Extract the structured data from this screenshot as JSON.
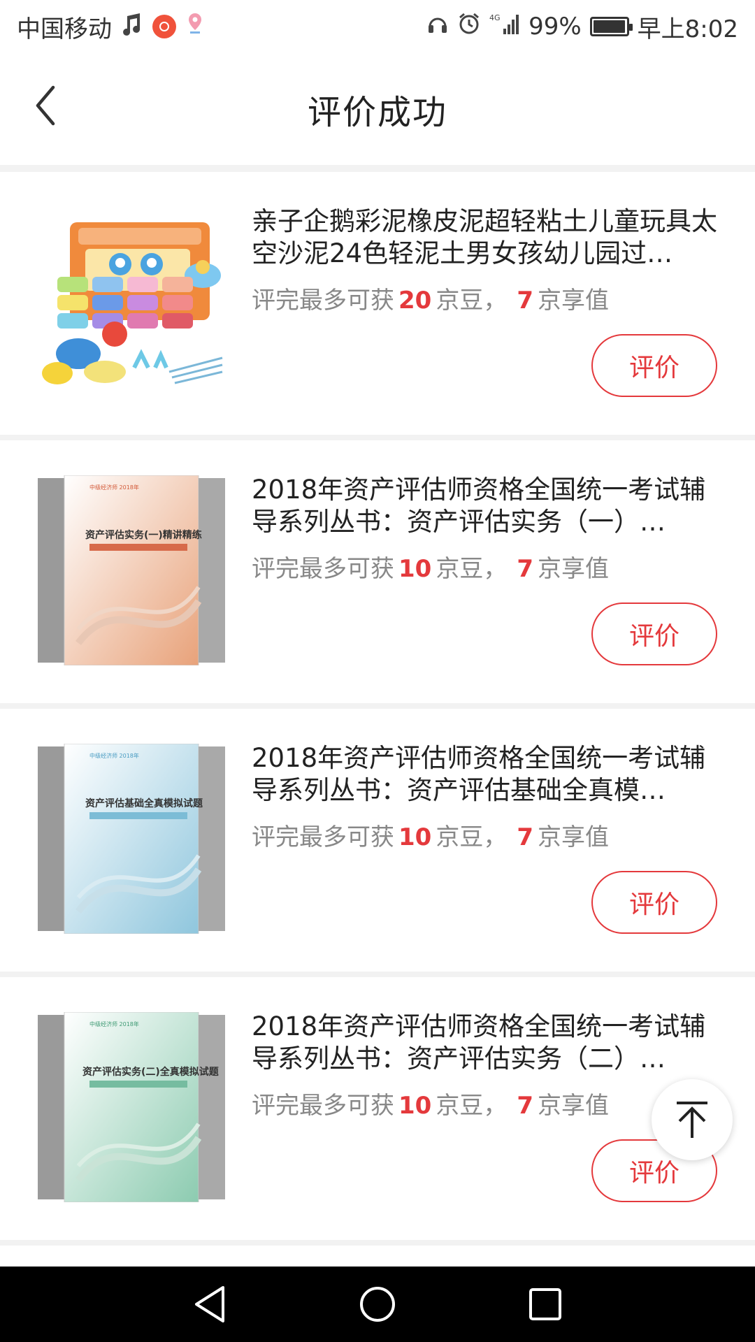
{
  "status_bar": {
    "carrier": "中国移动",
    "network": "4G",
    "battery": "99%",
    "battery_level": 0.99,
    "time": "早上8:02"
  },
  "header": {
    "title": "评价成功"
  },
  "items": [
    {
      "title": "亲子企鹅彩泥橡皮泥超轻粘土儿童玩具太空沙泥24色轻泥土男女孩幼儿园过…",
      "reward_prefix": "评完最多可获",
      "beans": "20",
      "beans_unit": "京豆，",
      "value": "7",
      "value_unit": "京享值",
      "button": "评价",
      "thumb_kind": "toy"
    },
    {
      "title": "2018年资产评估师资格全国统一考试辅导系列丛书：资产评估实务（一）…",
      "reward_prefix": "评完最多可获",
      "beans": "10",
      "beans_unit": "京豆，",
      "value": "7",
      "value_unit": "京享值",
      "button": "评价",
      "thumb_kind": "book",
      "book_title": "资产评估实务(一)精讲精练",
      "book_color": "#e8a27a"
    },
    {
      "title": "2018年资产评估师资格全国统一考试辅导系列丛书：资产评估基础全真模…",
      "reward_prefix": "评完最多可获",
      "beans": "10",
      "beans_unit": "京豆，",
      "value": "7",
      "value_unit": "京享值",
      "button": "评价",
      "thumb_kind": "book",
      "book_title": "资产评估基础全真模拟试题",
      "book_color": "#8fc6dd"
    },
    {
      "title": "2018年资产评估师资格全国统一考试辅导系列丛书：资产评估实务（二）…",
      "reward_prefix": "评完最多可获",
      "beans": "10",
      "beans_unit": "京豆，",
      "value": "7",
      "value_unit": "京享值",
      "button": "评价",
      "thumb_kind": "book",
      "book_title": "资产评估实务(二)全真模拟试题",
      "book_color": "#8ccbb0"
    }
  ],
  "colors": {
    "accent": "#e4393c",
    "muted_text": "#888888"
  },
  "icons": {
    "back": "chevron-left-icon",
    "to_top": "arrow-up-to-line-icon",
    "nav_back": "triangle-back-icon",
    "nav_home": "circle-home-icon",
    "nav_recent": "square-recent-icon"
  }
}
